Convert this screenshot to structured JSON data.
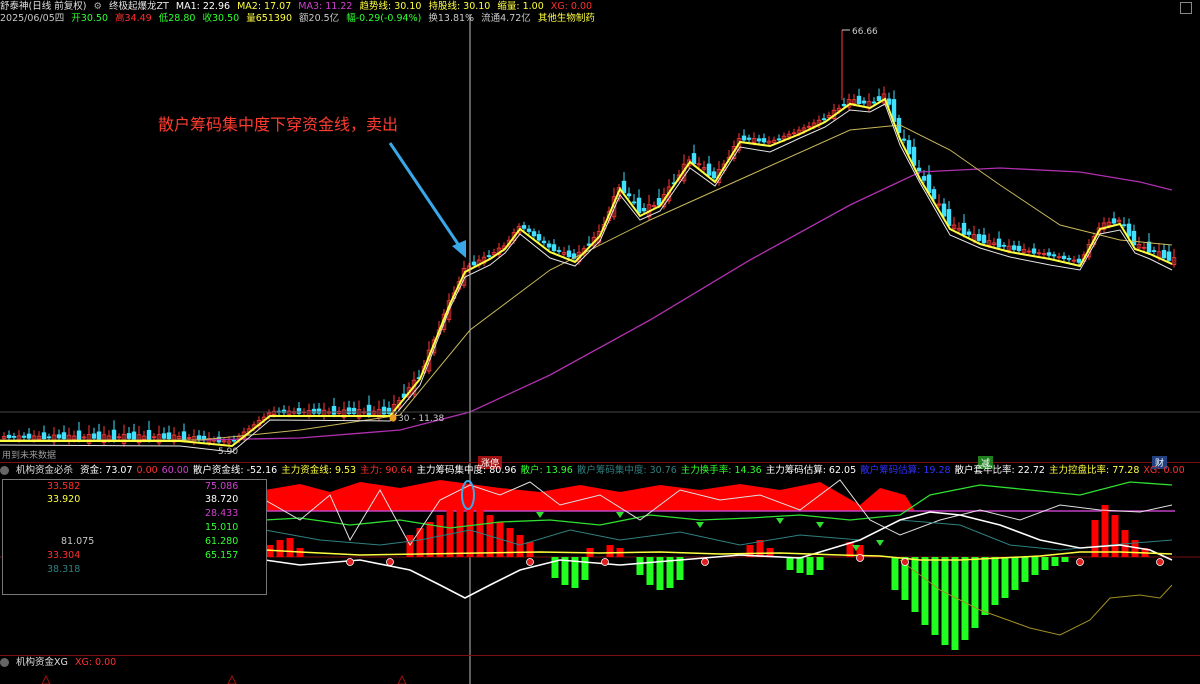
{
  "header": {
    "title": "舒泰神(日线 前复权)",
    "indicator": "终极起爆龙ZT",
    "ma1": "MA1: 22.96",
    "ma2": "MA2: 17.07",
    "ma3": "MA3: 11.22",
    "trend": "趋势线: 30.10",
    "hold": "持股线: 30.10",
    "vol": "缩量: 1.00",
    "xg": "XG: 0.00"
  },
  "info": {
    "date": "2025/06/05四",
    "open": "开30.50",
    "high": "高34.49",
    "low": "低28.80",
    "close": "收30.50",
    "volume": "量651390",
    "amount": "额20.5亿",
    "change": "幅-0.29(-0.94%)",
    "turnover": "换13.81%",
    "float": "流通4.72亿",
    "sector": "其他生物制药"
  },
  "main_chart": {
    "annotation": "散户筹码集中度下穿资金线，卖出",
    "high_label": "66.66",
    "low_label": "5.90",
    "price_hint": "30 - 11.38",
    "future_note": "用到未来数据",
    "tags": [
      "涨停",
      "减",
      "财"
    ]
  },
  "indicator_panel": {
    "title": "机构资金必杀",
    "items": [
      {
        "label": "资金: 73.07",
        "color": "#ffffff"
      },
      {
        "label": "0.00",
        "color": "#ff3030"
      },
      {
        "label": "60.00",
        "color": "#d040d0"
      },
      {
        "label": "散户资金线: -52.16",
        "color": "#ffffff"
      },
      {
        "label": "主力资金线: 9.53",
        "color": "#ffff40"
      },
      {
        "label": "主力: 90.64",
        "color": "#ff3030"
      },
      {
        "label": "主力筹码集中度: 80.96",
        "color": "#ffffff"
      },
      {
        "label": "散户: 13.96",
        "color": "#30ff30"
      },
      {
        "label": "散户筹码集中度: 30.76",
        "color": "#308080"
      },
      {
        "label": "主力换手率: 14.36",
        "color": "#30ff30"
      },
      {
        "label": "主力筹码估算: 62.05",
        "color": "#ffffff"
      },
      {
        "label": "散户筹码估算: 19.28",
        "color": "#3030ff"
      },
      {
        "label": "散户套牢比率: 22.72",
        "color": "#ffffff"
      },
      {
        "label": "主力控盘比率: 77.28",
        "color": "#ffff40"
      },
      {
        "label": "XG: 0.00",
        "color": "#ff3030"
      }
    ],
    "table": [
      {
        "value": "33.582",
        "color": "#ff3030"
      },
      {
        "value": "75.086",
        "color": "#d040d0"
      },
      {
        "value": "33.920",
        "color": "#ffff40"
      },
      {
        "value": "38.720",
        "color": "#ffffff"
      },
      {
        "value": "28.433",
        "color": "#d040d0"
      },
      {
        "value": "15.010",
        "color": "#30ff30"
      },
      {
        "value": "81.075",
        "color": "#c8c8c8"
      },
      {
        "value": "61.280",
        "color": "#30ff30"
      },
      {
        "value": "33.304",
        "color": "#ff3030"
      },
      {
        "value": "65.157",
        "color": "#30ff30"
      },
      {
        "value": "38.318",
        "color": "#308080"
      }
    ]
  },
  "bottom_panel": {
    "title": "机构资金XG",
    "xg": "XG: 0.00"
  },
  "colors": {
    "candle_up": "#ff3a3a",
    "candle_down": "#40e0ff",
    "ma_yellow": "#ffff40",
    "ma_white": "#e0e0e0",
    "ma_khaki": "#c8b85a",
    "ma_purple": "#b030b0",
    "area_red": "#ff0000",
    "bar_green": "#20ff20"
  }
}
